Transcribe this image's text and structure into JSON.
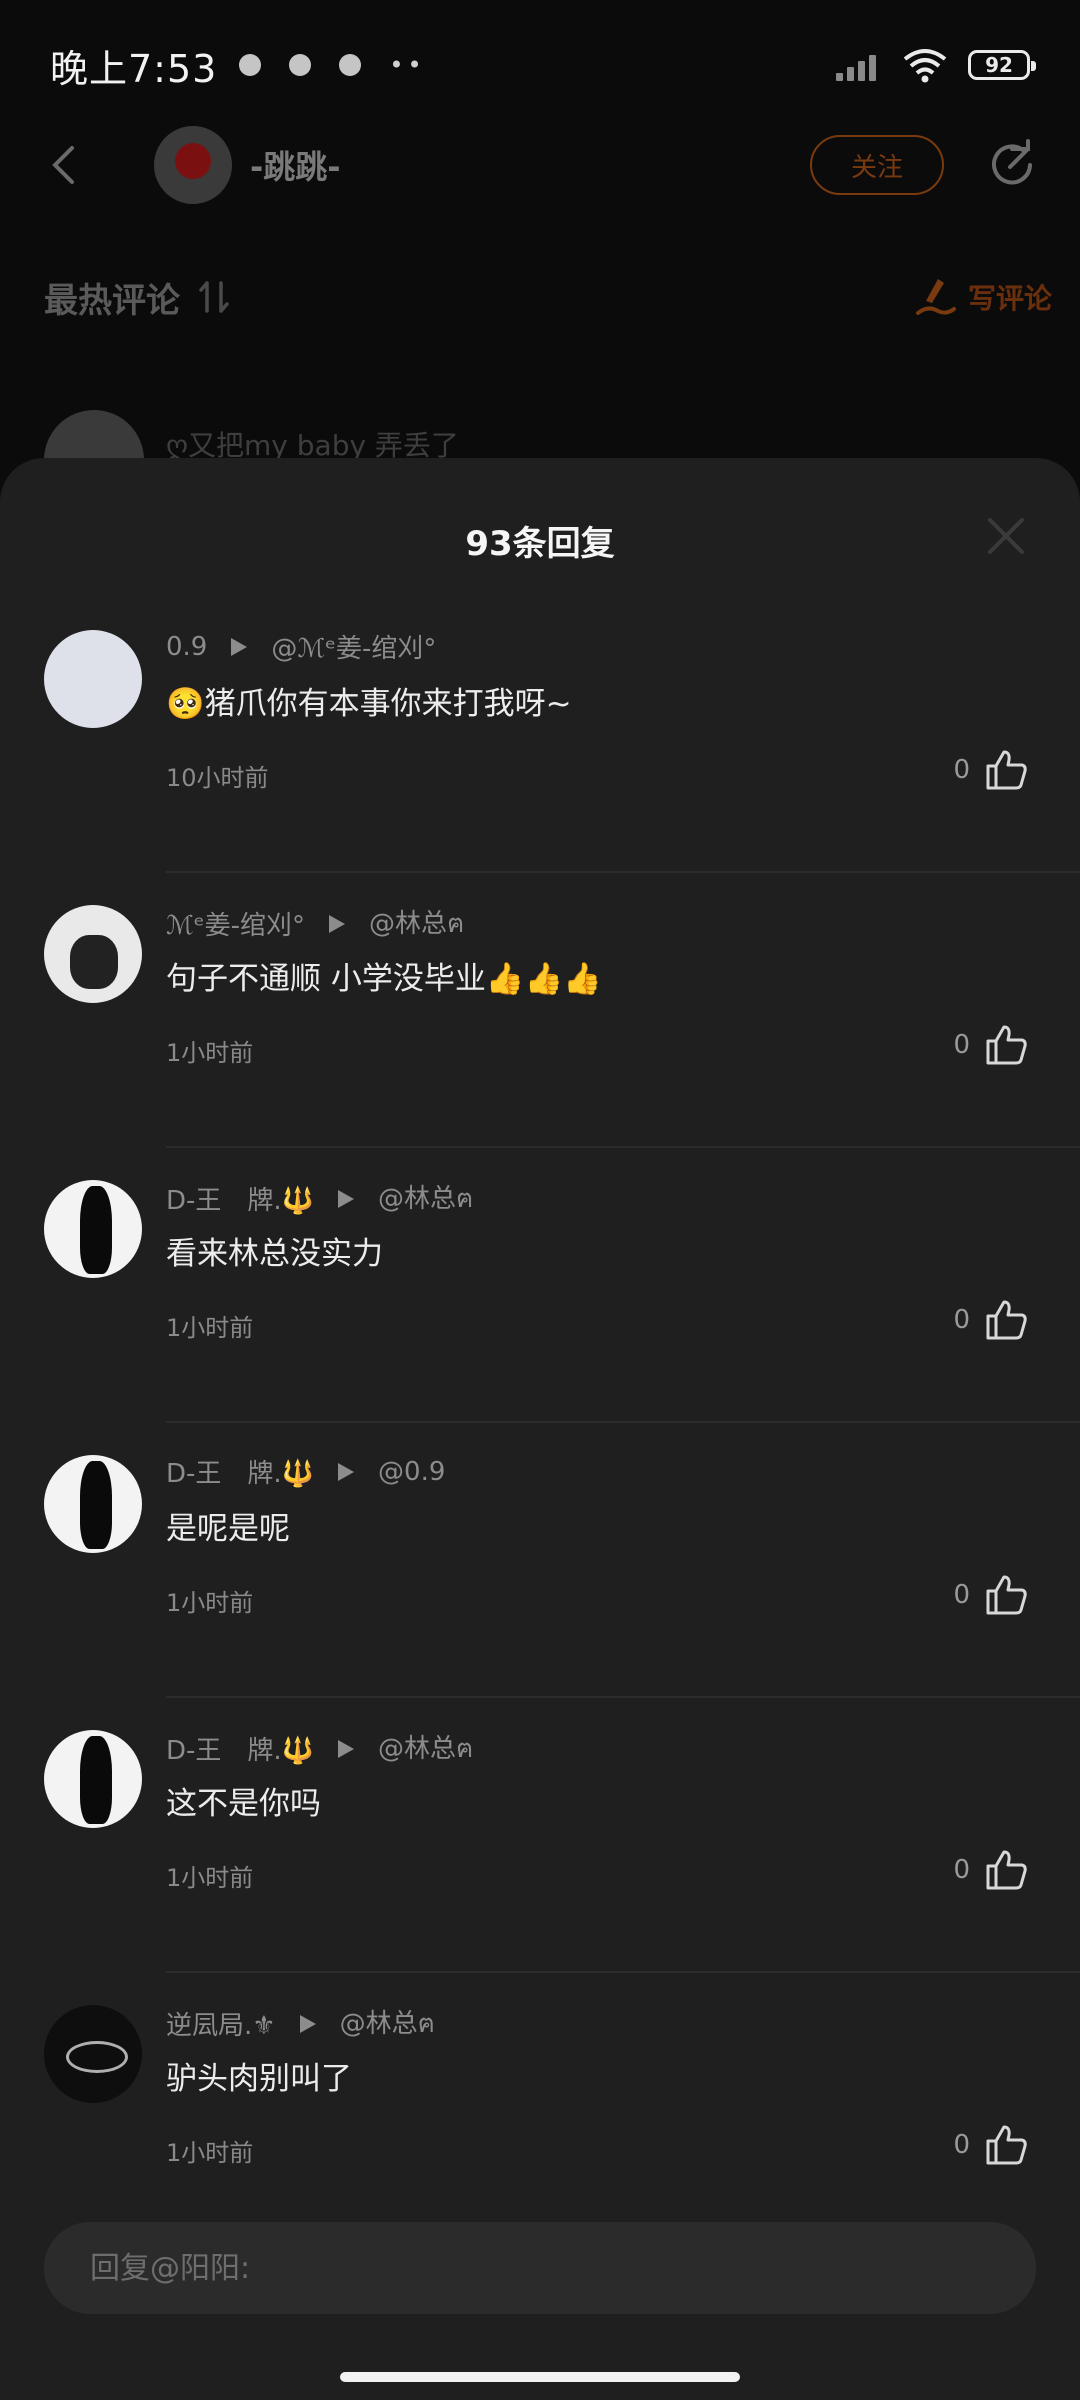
{
  "status": {
    "time": "晚上7:53",
    "notifications": [
      "alarm-app-icon",
      "bird-app-icon",
      "clock-app-icon"
    ],
    "more": "••",
    "battery": "92"
  },
  "header": {
    "author_name": "-跳跳-",
    "follow_label": "关注"
  },
  "comments_section": {
    "title": "最热评论",
    "write_label": "写评论",
    "preview_text": "ღ又把my baby 弄丢了"
  },
  "sheet": {
    "title": "93条回复",
    "replies": [
      {
        "author": "0.9",
        "reply_to": "@ℳᵉ姜-绾刈°",
        "text": "🥺猪爪你有本事你来打我呀~",
        "time": "10小时前",
        "likes": "0",
        "avatar": "blank-avatar"
      },
      {
        "author": "ℳᵉ姜-绾刈°",
        "reply_to": "@林总ฅ",
        "text": "句子不通顺 小学没毕业👍👍👍",
        "time": "1小时前",
        "likes": "0",
        "avatar": "doll-avatar"
      },
      {
        "author": "D-王　牌.🔱",
        "reply_to": "@林总ฅ",
        "text": "看来林总没实力",
        "time": "1小时前",
        "likes": "0",
        "avatar": "figure-avatar"
      },
      {
        "author": "D-王　牌.🔱",
        "reply_to": "@0.9",
        "text": "是呢是呢",
        "time": "1小时前",
        "likes": "0",
        "avatar": "figure-avatar"
      },
      {
        "author": "D-王　牌.🔱",
        "reply_to": "@林总ฅ",
        "text": "这不是你吗",
        "time": "1小时前",
        "likes": "0",
        "avatar": "figure-avatar"
      },
      {
        "author": "逆凨局.⚜",
        "reply_to": "@林总ฅ",
        "text": "驴头肉别叫了",
        "time": "1小时前",
        "likes": "0",
        "avatar": "dark-avatar"
      }
    ],
    "input_placeholder": "回复@阳阳:"
  },
  "colors": {
    "sheet_bg": "#1f1f1f",
    "page_bg": "#0b0b0b",
    "follow_accent": "#7a3a10"
  }
}
